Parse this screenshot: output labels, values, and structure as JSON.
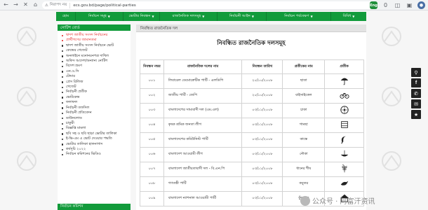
{
  "browser": {
    "security_label": "নিরাপদ নয়",
    "url": "ecs.gov.bd/page/political-parties",
    "extensions": [
      "Eng",
      "0"
    ]
  },
  "topnav": {
    "items": [
      {
        "label": "হোম",
        "dropdown": false
      },
      {
        "label": "নির্বাচন সমূহ",
        "dropdown": true
      },
      {
        "label": "ভোটার নিবন্ধন",
        "dropdown": true
      },
      {
        "label": "রাজনৈতিক দলসমূহ",
        "dropdown": true
      },
      {
        "label": "নির্বাচনী আইন",
        "dropdown": true
      },
      {
        "label": "নির্বাচন পর্যবেক্ষণ",
        "dropdown": true
      },
      {
        "label": "বিবিধ",
        "dropdown": true
      }
    ]
  },
  "sidebar": {
    "title": "নোটিশ বোর্ড",
    "items": [
      {
        "label": "দ্বাদশ জাতীয় সংসদ নির্বাচনের",
        "highlight": true
      },
      {
        "label": "প্রার্থীগণের জামানতমা",
        "highlight": true
      },
      {
        "label": "দ্বাদশ জাতীয় সংসদ নির্বাচনে ভোট",
        "highlight": false
      },
      {
        "label": "কেন্দ্রের গেজেট",
        "highlight": false
      },
      {
        "label": "অনলাইনে মনোনয়নপত্র দাখিল",
        "highlight": false
      },
      {
        "label": "অফিস আদেশ/অন্যান্য নোটিশ",
        "highlight": false
      },
      {
        "label": "বিদেশ ভ্রমণ",
        "highlight": false
      },
      {
        "label": "এন.ও.সি",
        "highlight": false
      },
      {
        "label": "টেন্ডার",
        "highlight": false
      },
      {
        "label": "প্রেস রিলিজ",
        "highlight": false
      },
      {
        "label": "গেজেট",
        "highlight": false
      },
      {
        "label": "নির্বাচনী প্রতীক",
        "highlight": false
      },
      {
        "label": "ভোটকেন্দ্র",
        "highlight": false
      },
      {
        "label": "ফলাফল",
        "highlight": false
      },
      {
        "label": "নির্বাচনী তফসিল",
        "highlight": false
      },
      {
        "label": "নির্বাচনী প্রতিবেদন",
        "highlight": false
      },
      {
        "label": "ডাউনলোড",
        "highlight": false
      },
      {
        "label": "চাকুরী",
        "highlight": false
      },
      {
        "label": "বিজ্ঞপ্তি মামলা",
        "highlight": false
      },
      {
        "label": "ছবি সহ ও ছবি ছাড়া ভোটার তালিকা",
        "highlight": false
      },
      {
        "label": "ই-ভি-এম এ ভোট দেওয়ার পদ্ধতি",
        "highlight": false
      },
      {
        "label": "ভোটার তালিকা হালনাগাদ",
        "highlight": false
      },
      {
        "label": "কর্মসূচি ২০২২",
        "highlight": false
      },
      {
        "label": "নির্বাচন কমিশনের ভিডিও",
        "highlight": false
      }
    ],
    "footer": "নির্বাচন কমিশন"
  },
  "main": {
    "section_title": "নিবন্ধিত রাজনৈতিক দল",
    "heading": "নিবন্ধিত রাজনৈতিক দলসমূহ",
    "table": {
      "headers": [
        "নিবন্ধন নম্বর",
        "রাজনৈতিক দলের নাম",
        "নিবন্ধন তারিখ",
        "প্রতীকের নাম",
        "প্রতীক"
      ],
      "rows": [
        {
          "no": "০০১",
          "name": "লিবারেল ডেমোক্রেটিক পার্টি - এলডিপি",
          "date": "২০/১০/২০০৮",
          "symbol": "ছাতা",
          "icon": "umbrella-icon"
        },
        {
          "no": "০০২",
          "name": "জাতীয় পার্টি - জেপি",
          "date": "২০/১০/২০০৮",
          "symbol": "বাইসাইকেল",
          "icon": "bicycle-icon"
        },
        {
          "no": "০০৩",
          "name": "বাংলাদেশের সাম্যবাদী দল (এম.এল)",
          "date": "০৩/১১/২০০৮",
          "symbol": "চাকা",
          "icon": "wheel-icon"
        },
        {
          "no": "০০৪",
          "name": "কৃষক শ্রমিক জনতা লীগ",
          "date": "০৩/১১/২০০৮",
          "symbol": "গামছা",
          "icon": "towel-icon"
        },
        {
          "no": "০০৫",
          "name": "বাংলাদেশের কমিউনিস্ট পার্টি",
          "date": "০৩/১১/২০০৮",
          "symbol": "কাস্তে",
          "icon": "sickle-icon"
        },
        {
          "no": "০০৬",
          "name": "বাংলাদেশ আওয়ামী লীগ",
          "date": "০৩/১১/২০০৮",
          "symbol": "নৌকা",
          "icon": "boat-icon"
        },
        {
          "no": "০০৭",
          "name": "বাংলাদেশ জাতীয়তাবাদী দল - বি.এন.পি",
          "date": "০৩/১১/২০০৮",
          "symbol": "ধানের শীষ",
          "icon": "paddy-icon"
        },
        {
          "no": "০০৮",
          "name": "গণতন্ত্রী পার্টি",
          "date": "০৩/১১/২০০৮",
          "symbol": "কবুতর",
          "icon": "pigeon-icon"
        },
        {
          "no": "০০৯",
          "name": "বাংলাদেশ ন্যাশনাল আওয়ামী পার্টি",
          "date": "০৩/১১/২০০৮",
          "symbol": "কুঁড়েঘর",
          "icon": "hut-icon"
        }
      ]
    }
  },
  "watermark": "公众号 · 阿富汗资讯",
  "colors": {
    "accent": "#129b3b",
    "highlight": "#e41b1b"
  }
}
